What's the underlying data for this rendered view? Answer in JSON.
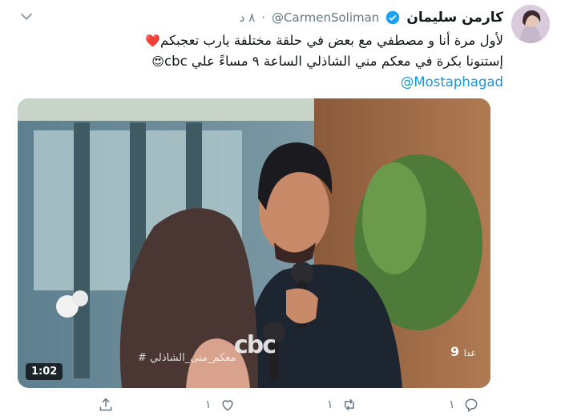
{
  "tweet": {
    "name": "كارمن سليمان",
    "handle": "@CarmenSoliman",
    "dot": "·",
    "time": "٨ د",
    "line1": "لأول مرة أنا و مصطفي مع بعض في حلقة مختلفة يارب تعجبكم",
    "line1_emoji": "❤️",
    "line2": "إستنونا بكرة في معكم مني الشاذلي الساعة ٩ مساءً علي cbc",
    "line2_emoji": "😍",
    "mention": "@Mostaphagad"
  },
  "media": {
    "duration": "1:02",
    "watermark": "# معكم_منى_الشاذلي",
    "channel_logo": "cbc",
    "schedule_time": "9",
    "schedule_word": "غدا"
  },
  "actions": {
    "reply_count": "١",
    "retweet_count": "١",
    "like_count": "١"
  },
  "colors": {
    "link": "#1b95e0",
    "muted": "#657786",
    "verified": "#1da1f2"
  }
}
